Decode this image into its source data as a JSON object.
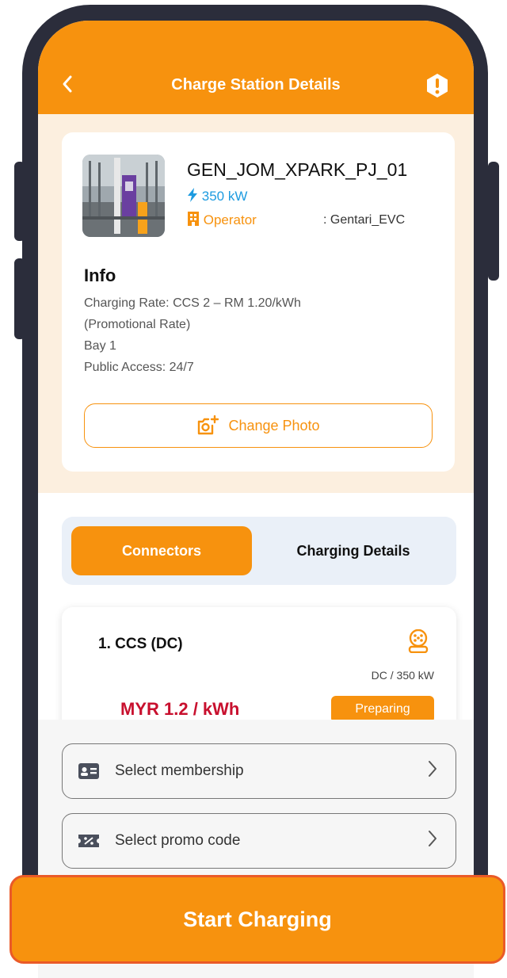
{
  "header": {
    "title": "Charge Station Details",
    "back_icon": "chevron-left-icon",
    "alert_icon": "alert-icon"
  },
  "station": {
    "name": "GEN_JOM_XPARK_PJ_01",
    "power": "350 kW",
    "operator_label": "Operator",
    "operator_value": ": Gentari_EVC"
  },
  "info": {
    "title": "Info",
    "lines": [
      "Charging Rate: CCS 2 – RM 1.20/kWh",
      "(Promotional Rate)",
      "Bay 1",
      "Public Access: 24/7"
    ]
  },
  "change_photo_label": "Change Photo",
  "tabs": [
    {
      "label": "Connectors",
      "active": true
    },
    {
      "label": "Charging Details",
      "active": false
    }
  ],
  "connector": {
    "title": "1.  CCS (DC)",
    "subtitle": "DC / 350 kW",
    "price": "MYR 1.2 / kWh",
    "status": "Preparing"
  },
  "membership": {
    "label": "Select membership"
  },
  "promo": {
    "label": "Select promo code"
  },
  "start_button": {
    "label": "Start Charging"
  },
  "colors": {
    "accent": "#f7920e",
    "power": "#1d9be0",
    "price": "#c8102e",
    "frame": "#2b2d3b"
  }
}
